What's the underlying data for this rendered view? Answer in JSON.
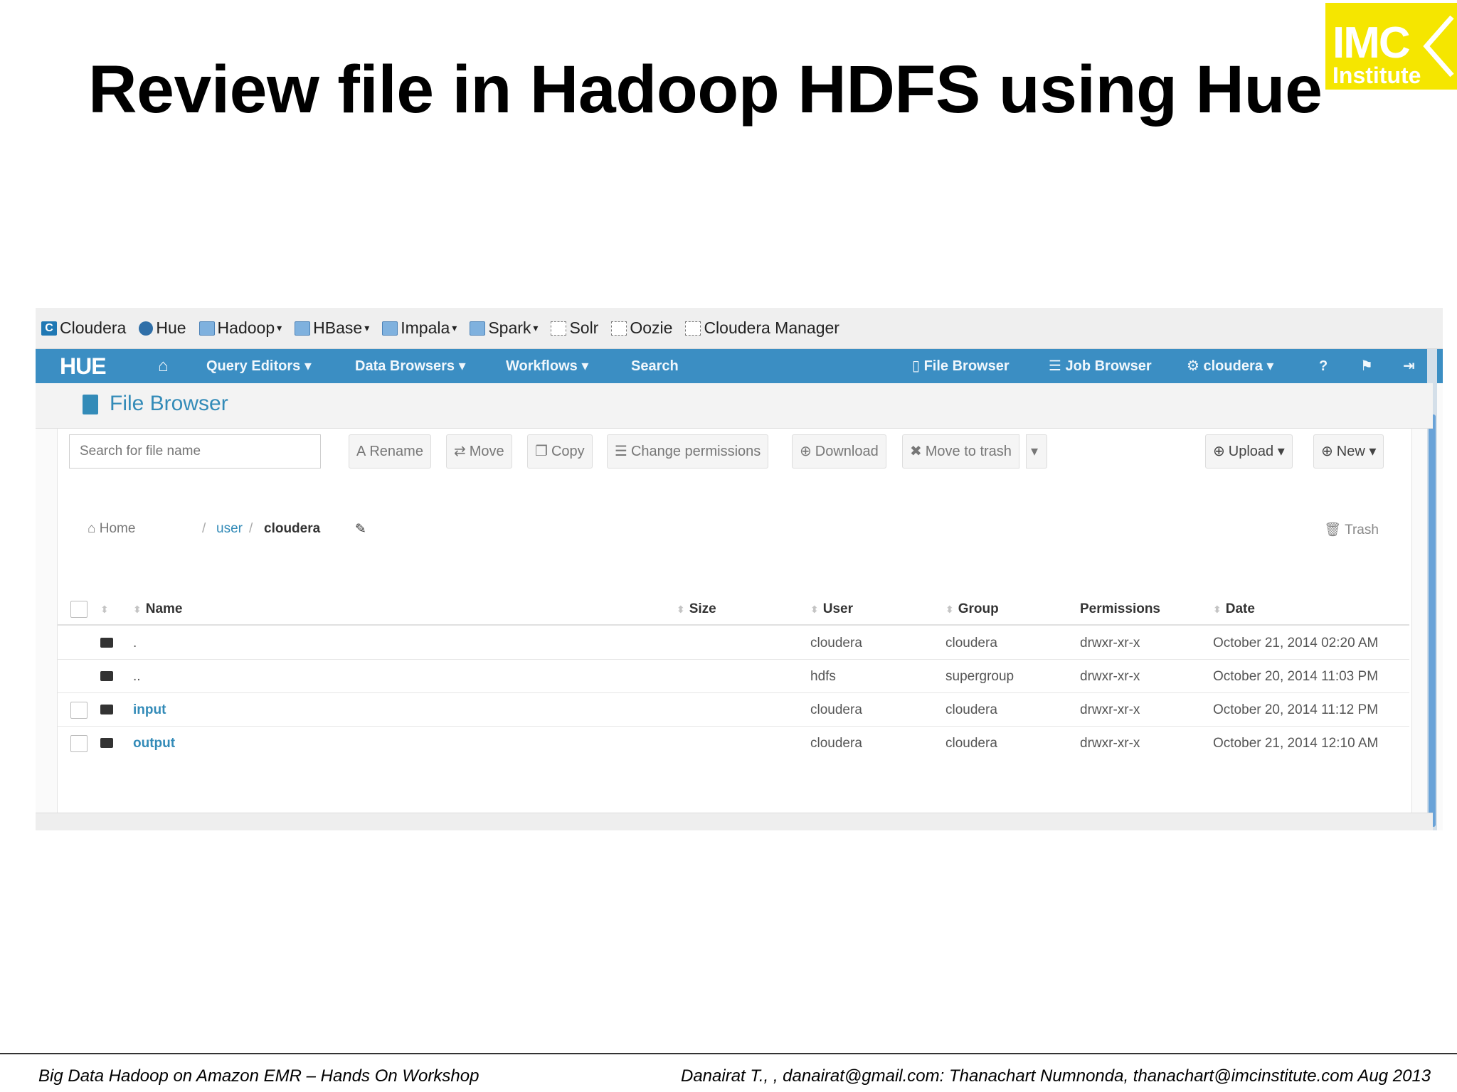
{
  "slide": {
    "title": "Review file in Hadoop HDFS using Hue",
    "logo": {
      "line1": "IMC",
      "line2": "Institute",
      "color": "#f5e600"
    },
    "footer_left": "Big Data Hadoop on Amazon EMR – Hands On Workshop",
    "footer_right": "Danairat T., , danairat@gmail.com:  Thanachart Numnonda,  thanachart@imcinstitute.com   Aug 2013"
  },
  "bookmarks": [
    {
      "label": "Cloudera",
      "icon": "cloudera-icon",
      "dropdown": false
    },
    {
      "label": "Hue",
      "icon": "hue-icon",
      "dropdown": false
    },
    {
      "label": "Hadoop",
      "icon": "folder-icon",
      "dropdown": true
    },
    {
      "label": "HBase",
      "icon": "folder-icon",
      "dropdown": true
    },
    {
      "label": "Impala",
      "icon": "folder-icon",
      "dropdown": true
    },
    {
      "label": "Spark",
      "icon": "folder-icon",
      "dropdown": true
    },
    {
      "label": "Solr",
      "icon": "page-icon",
      "dropdown": false
    },
    {
      "label": "Oozie",
      "icon": "page-icon",
      "dropdown": false
    },
    {
      "label": "Cloudera Manager",
      "icon": "page-icon",
      "dropdown": false
    }
  ],
  "navbar": {
    "logo": "HUE",
    "query_editors": "Query Editors",
    "data_browsers": "Data Browsers",
    "workflows": "Workflows",
    "search": "Search",
    "file_browser": "File Browser",
    "job_browser": "Job Browser",
    "user": "cloudera",
    "color": "#3b8ec3"
  },
  "page": {
    "title": "File Browser"
  },
  "toolbar": {
    "search_placeholder": "Search for file name",
    "rename": "Rename",
    "move": "Move",
    "copy": "Copy",
    "change_permissions": "Change permissions",
    "download": "Download",
    "move_to_trash": "Move to trash",
    "upload": "Upload",
    "new": "New"
  },
  "breadcrumb": {
    "home": "Home",
    "user": "user",
    "current": "cloudera",
    "trash": "Trash"
  },
  "table": {
    "headers": {
      "name": "Name",
      "size": "Size",
      "user": "User",
      "group": "Group",
      "permissions": "Permissions",
      "date": "Date"
    },
    "rows": [
      {
        "name": ".",
        "size": "",
        "user": "cloudera",
        "group": "cloudera",
        "permissions": "drwxr-xr-x",
        "date": "October 21, 2014 02:20 AM",
        "selectable": false
      },
      {
        "name": "..",
        "size": "",
        "user": "hdfs",
        "group": "supergroup",
        "permissions": "drwxr-xr-x",
        "date": "October 20, 2014 11:03 PM",
        "selectable": false
      },
      {
        "name": "input",
        "size": "",
        "user": "cloudera",
        "group": "cloudera",
        "permissions": "drwxr-xr-x",
        "date": "October 20, 2014 11:12 PM",
        "selectable": true
      },
      {
        "name": "output",
        "size": "",
        "user": "cloudera",
        "group": "cloudera",
        "permissions": "drwxr-xr-x",
        "date": "October 21, 2014 12:10 AM",
        "selectable": true
      }
    ]
  }
}
